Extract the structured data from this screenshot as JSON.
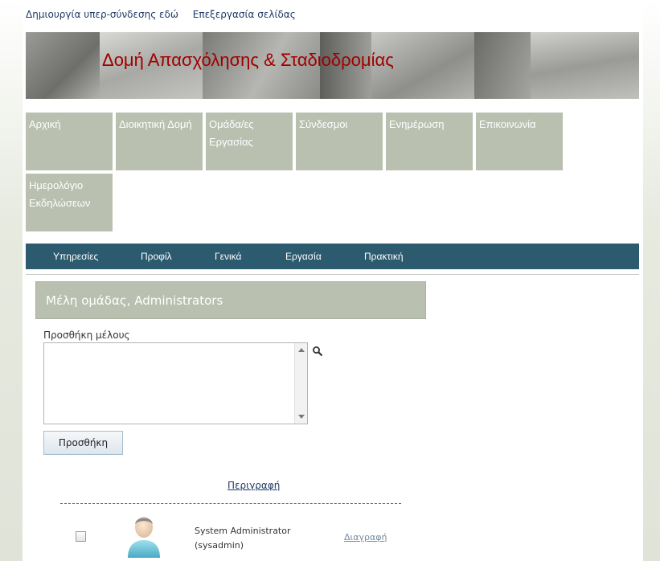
{
  "top_links": {
    "create_link": "Δημιουργία υπερ-σύνδεσης εδώ",
    "edit_page": "Επεξεργασία σελίδας"
  },
  "banner": {
    "title": "Δομή Απασχόλησης & Σταδιοδρομίας"
  },
  "menu_tiles": [
    {
      "label": "Αρχική"
    },
    {
      "label": "Διοικητική Δομή"
    },
    {
      "label": "Ομάδα/ες Εργασίας"
    },
    {
      "label": "Σύνδεσμοι"
    },
    {
      "label": "Ενημέρωση"
    },
    {
      "label": "Επικοινωνία"
    },
    {
      "label": "Ημερολόγιο Εκδηλώσεων"
    }
  ],
  "navbar": {
    "items": [
      "Υπηρεσίες",
      "Προφίλ",
      "Γενικά",
      "Εργασία",
      "Πρακτική"
    ],
    "color": "#2c5a6e"
  },
  "group_header": "Μέλη ομάδας, Administrators",
  "add_member": {
    "label": "Προσθήκη μέλους",
    "value": "",
    "button": "Προσθήκη"
  },
  "members_table": {
    "column_header": "Περιγραφή",
    "rows": [
      {
        "name": "System Administrator",
        "username": "(sysadmin)",
        "action": "Διαγραφή",
        "checked": false
      }
    ]
  },
  "icons": {
    "lookup": "magnifier-icon",
    "avatar": "user-avatar-icon"
  },
  "colors": {
    "tile": "#b9c0b0",
    "title_red": "#a00000",
    "link_blue": "#1e3a66"
  }
}
